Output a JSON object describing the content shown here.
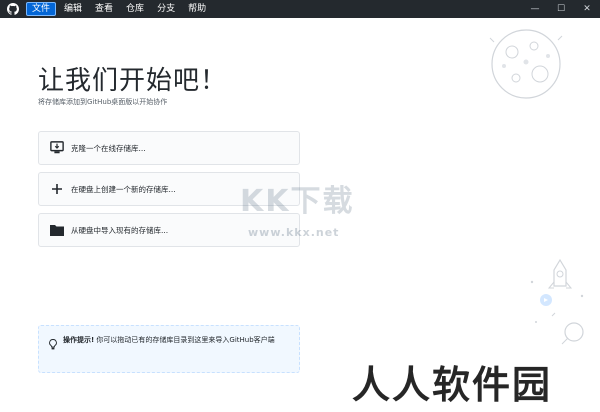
{
  "menu": {
    "items": [
      {
        "label": "文件",
        "active": true
      },
      {
        "label": "编辑",
        "active": false
      },
      {
        "label": "查看",
        "active": false
      },
      {
        "label": "仓库",
        "active": false
      },
      {
        "label": "分支",
        "active": false
      },
      {
        "label": "帮助",
        "active": false
      }
    ]
  },
  "window_controls": {
    "minimize": "—",
    "maximize": "☐",
    "close": "✕"
  },
  "main": {
    "title": "让我们开始吧！",
    "subtitle": "将存储库添加到GitHub桌面版以开始协作"
  },
  "options": [
    {
      "icon": "desktop-download-icon",
      "label": "克隆一个在线存储库..."
    },
    {
      "icon": "plus-icon",
      "label": "在硬盘上创建一个新的存储库..."
    },
    {
      "icon": "folder-icon",
      "label": "从硬盘中导入现有的存储库..."
    }
  ],
  "tip": {
    "icon": "lightbulb-icon",
    "bold": "操作提示!",
    "text": " 你可以拖动已有的存储库目录到这里来导入GitHub客户端"
  },
  "watermarks": {
    "kk": "KK下载",
    "kk_url": "www.kkx.net",
    "rrrj": "人人软件园"
  },
  "colors": {
    "titlebar": "#24292e",
    "accent": "#0366d6",
    "tip_bg": "#f1f8ff"
  }
}
